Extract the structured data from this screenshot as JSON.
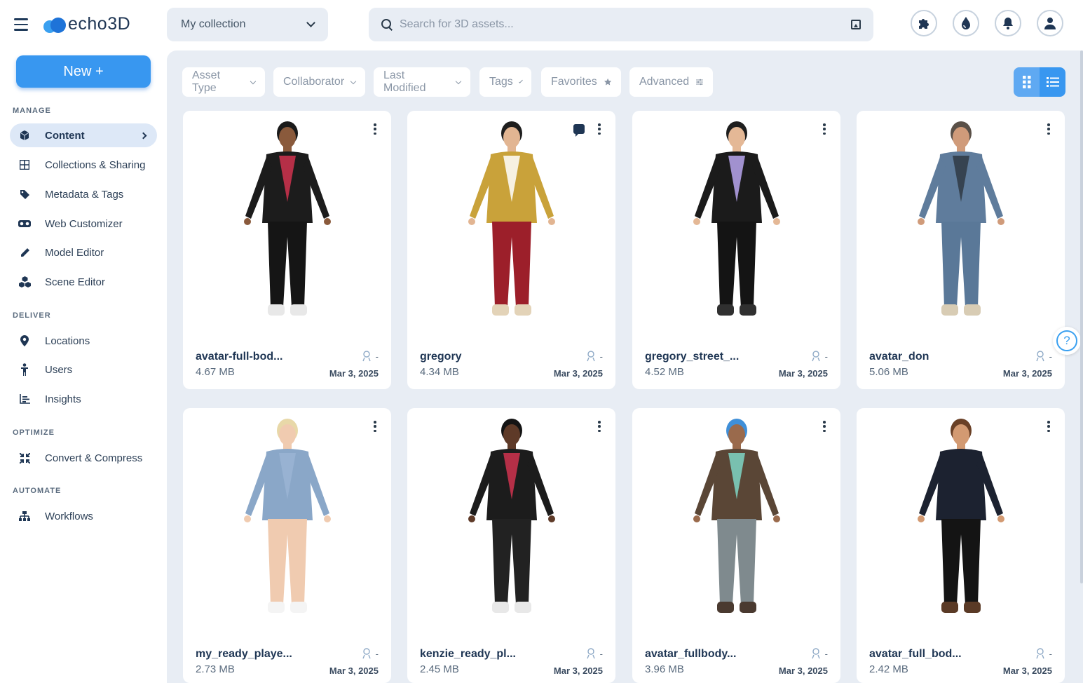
{
  "app": {
    "logo_text": "echo3D"
  },
  "header": {
    "collection_value": "My collection",
    "search_placeholder": "Search for 3D assets..."
  },
  "sidebar": {
    "new_button": "New +",
    "sections": {
      "manage": "MANAGE",
      "deliver": "DELIVER",
      "optimize": "OPTIMIZE",
      "automate": "AUTOMATE"
    },
    "items": [
      {
        "label": "Content",
        "icon": "cube-icon",
        "active": true
      },
      {
        "label": "Collections & Sharing",
        "icon": "grid-icon"
      },
      {
        "label": "Metadata & Tags",
        "icon": "tag-icon"
      },
      {
        "label": "Web Customizer",
        "icon": "vr-headset-icon"
      },
      {
        "label": "Model Editor",
        "icon": "pencil-icon"
      },
      {
        "label": "Scene Editor",
        "icon": "cubes-icon"
      },
      {
        "label": "Locations",
        "icon": "map-pin-icon"
      },
      {
        "label": "Users",
        "icon": "person-icon"
      },
      {
        "label": "Insights",
        "icon": "bar-chart-icon"
      },
      {
        "label": "Convert & Compress",
        "icon": "compress-icon"
      },
      {
        "label": "Workflows",
        "icon": "sitemap-icon"
      }
    ]
  },
  "filters": [
    {
      "label": "Asset Type"
    },
    {
      "label": "Collaborator"
    },
    {
      "label": "Last Modified"
    },
    {
      "label": "Tags"
    },
    {
      "label": "Favorites"
    },
    {
      "label": "Advanced"
    }
  ],
  "assets": [
    {
      "name": "avatar-full-bod...",
      "size": "4.67 MB",
      "date": "Mar 3, 2025",
      "owner": "-",
      "skin": "#8a5a3c",
      "hair": "#1a1a1a",
      "top": "#1c1c1c",
      "accent": "#d0334f",
      "legs": "#151515",
      "shoes": "#e8e8e8"
    },
    {
      "name": "gregory",
      "size": "4.34 MB",
      "date": "Mar 3, 2025",
      "owner": "-",
      "skin": "#e2b592",
      "hair": "#1e1e1e",
      "top": "#c9a23a",
      "accent": "#ffffff",
      "legs": "#9c1f2a",
      "shoes": "#e3d3b8",
      "comment": true
    },
    {
      "name": "gregory_street_...",
      "size": "4.52 MB",
      "date": "Mar 3, 2025",
      "owner": "-",
      "skin": "#e4b896",
      "hair": "#1e1e1e",
      "top": "#1b1b1b",
      "accent": "#b9a6ef",
      "legs": "#141414",
      "shoes": "#303030"
    },
    {
      "name": "avatar_don",
      "size": "5.06 MB",
      "date": "Mar 3, 2025",
      "owner": "-",
      "skin": "#d09b7a",
      "hair": "#5a5048",
      "top": "#5f7c9c",
      "accent": "#2f3a44",
      "legs": "#5a7898",
      "shoes": "#d8ccb4"
    },
    {
      "name": "my_ready_playe...",
      "size": "2.73 MB",
      "date": "Mar 3, 2025",
      "owner": "-",
      "skin": "#f0cbb0",
      "hair": "#e8d8a8",
      "top": "#8aa7c8",
      "accent": "#9ab4d4",
      "legs": "#f0cbb0",
      "shoes": "#f4f4f4"
    },
    {
      "name": "kenzie_ready_pl...",
      "size": "2.45 MB",
      "date": "Mar 3, 2025",
      "owner": "-",
      "skin": "#5e3a28",
      "hair": "#141414",
      "top": "#1c1c1c",
      "accent": "#d0334f",
      "legs": "#222222",
      "shoes": "#e8e8e8"
    },
    {
      "name": "avatar_fullbody...",
      "size": "3.96 MB",
      "date": "Mar 3, 2025",
      "owner": "-",
      "skin": "#9a6a4c",
      "hair": "#3f8fd8",
      "top": "#5a4636",
      "accent": "#7fd6c4",
      "legs": "#7f8a8e",
      "shoes": "#4a3a30"
    },
    {
      "name": "avatar_full_bod...",
      "size": "2.42 MB",
      "date": "Mar 3, 2025",
      "owner": "-",
      "skin": "#d39a72",
      "hair": "#6a4026",
      "top": "#1c2230",
      "accent": "#1c2230",
      "legs": "#141414",
      "shoes": "#5a3a26"
    }
  ],
  "help": {
    "label": "?"
  }
}
